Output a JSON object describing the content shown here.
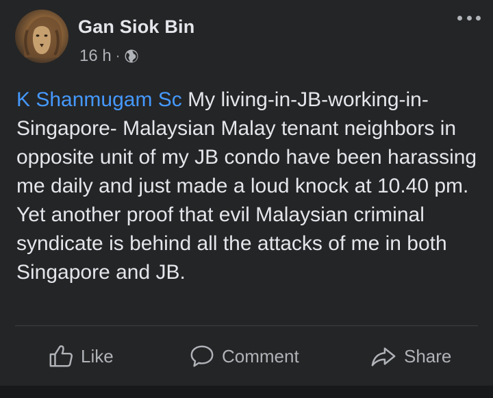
{
  "post": {
    "author": "Gan Siok Bin",
    "time": "16 h",
    "separator": "·",
    "privacy_icon": "globe-icon",
    "mention": "K Shanmugam Sc",
    "body": " My living-in-JB-working-in-Singapore- Malaysian Malay tenant neighbors in opposite unit of my JB condo have been harassing me daily and just made a loud knock at 10.40 pm. Yet another proof that evil Malaysian criminal syndicate is behind all the attacks of me in both Singapore and JB."
  },
  "actions": {
    "like": "Like",
    "comment": "Comment",
    "share": "Share"
  },
  "colors": {
    "background": "#242526",
    "text": "#e4e6eb",
    "secondary": "#b0b3b8",
    "mention": "#4599ff"
  }
}
